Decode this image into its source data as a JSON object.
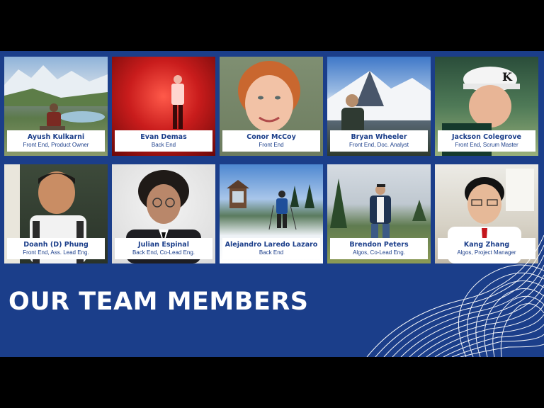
{
  "heading": "OUR TEAM MEMBERS",
  "colors": {
    "brand_blue": "#1b3e8a",
    "label_bg": "#ffffff",
    "heading_text": "#ffffff"
  },
  "members": [
    {
      "name": "Ayush Kulkarni",
      "role": "Front End, Product Owner"
    },
    {
      "name": "Evan Demas",
      "role": "Back End"
    },
    {
      "name": "Conor McCoy",
      "role": "Front End"
    },
    {
      "name": "Bryan Wheeler",
      "role": "Front End, Doc. Analyst"
    },
    {
      "name": "Jackson Colegrove",
      "role": "Front End, Scrum Master"
    },
    {
      "name": "Doanh (D) Phung",
      "role": "Front End, Ass. Lead Eng."
    },
    {
      "name": "Julian Espinal",
      "role": "Back End, Co-Lead Eng."
    },
    {
      "name": "Alejandro Laredo Lazaro",
      "role": "Back End"
    },
    {
      "name": "Brendon Peters",
      "role": "Algos, Co-Lead Eng."
    },
    {
      "name": "Kang Zhang",
      "role": "Algos, Project Manager"
    }
  ]
}
